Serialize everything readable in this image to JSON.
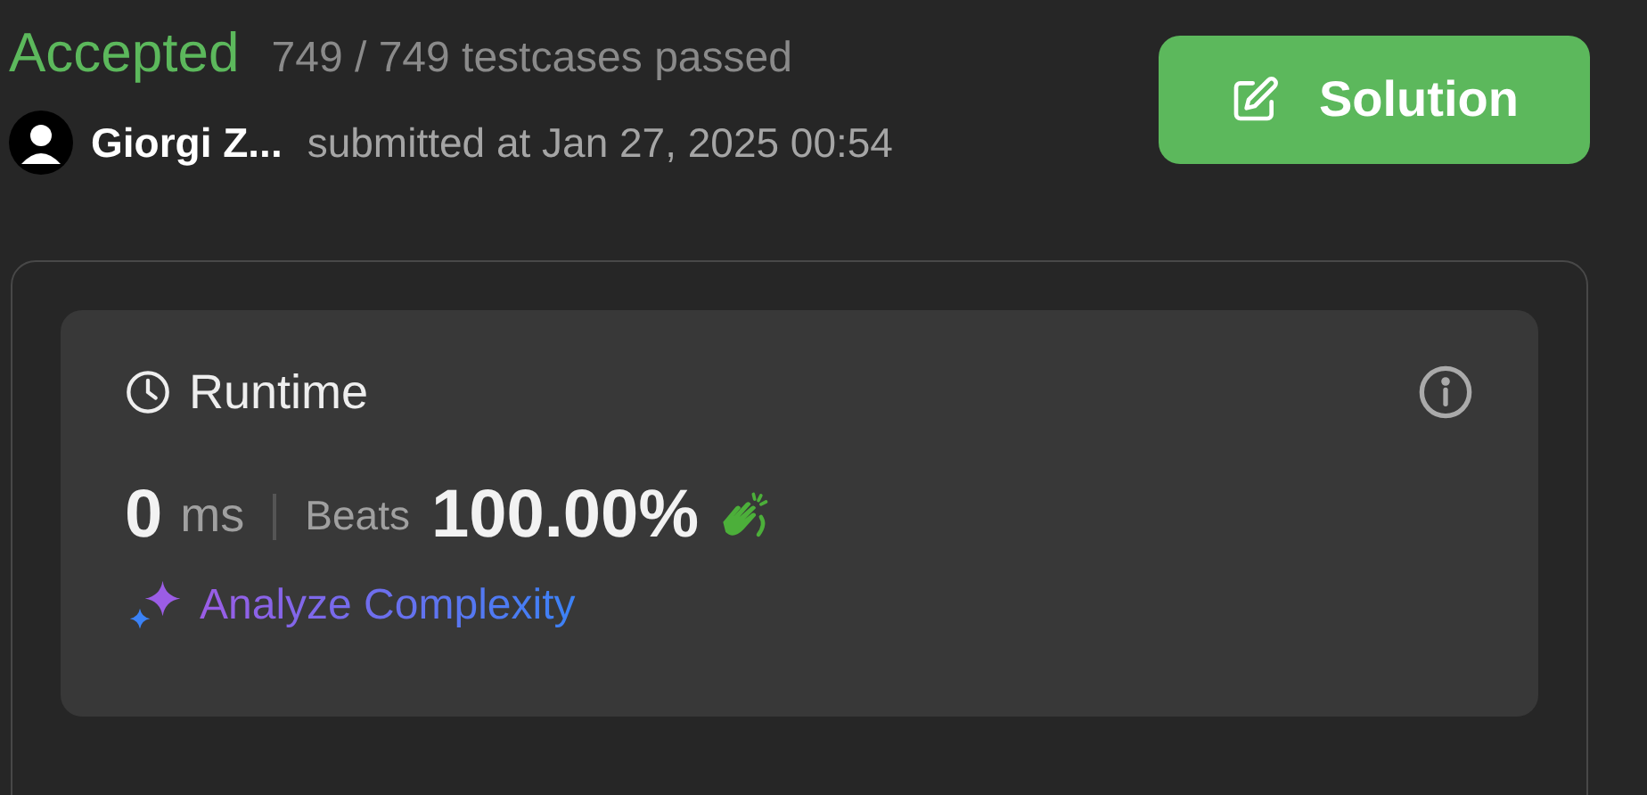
{
  "status": "Accepted",
  "testcases": "749 / 749 testcases passed",
  "author": {
    "name": "Giorgi Z...",
    "submitted": "submitted at Jan 27, 2025 00:54"
  },
  "solution_button": "Solution",
  "runtime": {
    "title": "Runtime",
    "value": "0",
    "unit": "ms",
    "beats_label": "Beats",
    "beats": "100.00%",
    "analyze_link": "Analyze Complexity"
  }
}
